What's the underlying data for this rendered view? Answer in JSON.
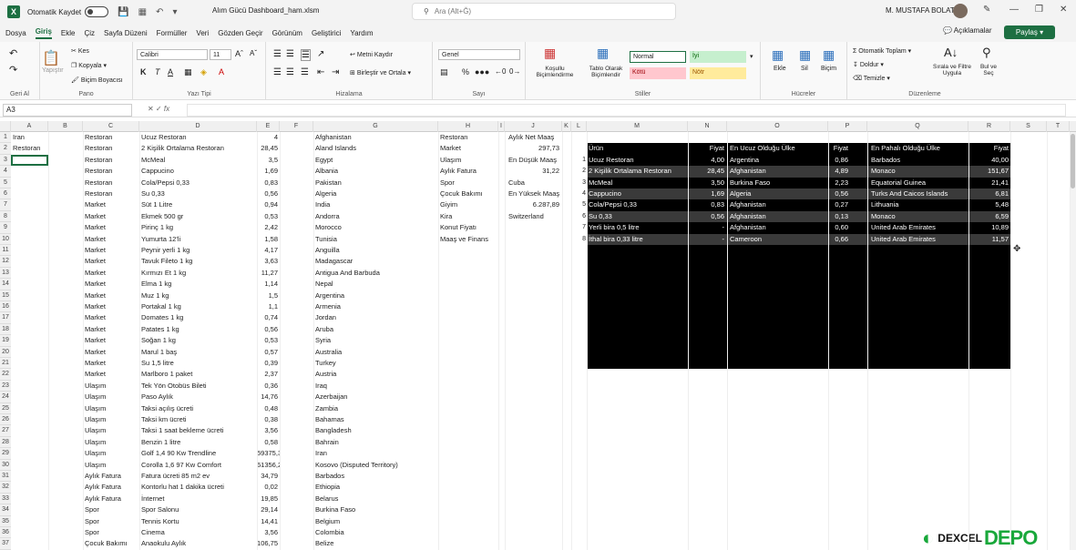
{
  "titlebar": {
    "autosave_label": "Otomatik Kaydet",
    "doc_title": "Alım Gücü Dashboard_ham.xlsm",
    "search_placeholder": "Ara (Alt+Ğ)",
    "user_name": "M. MUSTAFA BOLAT"
  },
  "menu": {
    "items": [
      "Dosya",
      "Giriş",
      "Ekle",
      "Çiz",
      "Sayfa Düzeni",
      "Formüller",
      "Veri",
      "Gözden Geçir",
      "Görünüm",
      "Geliştirici",
      "Yardım"
    ],
    "active_index": 1,
    "comments_label": "Açıklamalar",
    "share_label": "Paylaş"
  },
  "ribbon": {
    "groups": {
      "undo": "Geri Al",
      "clipboard": "Pano",
      "font": "Yazı Tipi",
      "alignment": "Hizalama",
      "number": "Sayı",
      "styles": "Stiller",
      "cells": "Hücreler",
      "editing": "Düzenleme"
    },
    "clipboard": {
      "paste": "Yapıştır",
      "cut": "Kes",
      "copy": "Kopyala",
      "format_painter": "Biçim Boyacısı"
    },
    "font": {
      "name": "Calibri",
      "size": "11"
    },
    "alignment": {
      "wrap": "Metni Kaydır",
      "merge": "Birleştir ve Ortala"
    },
    "number": {
      "format": "Genel"
    },
    "styles": {
      "conditional": "Koşullu Biçimlendirme",
      "table": "Tablo Olarak Biçimlendir",
      "normal": "Normal",
      "good": "İyi",
      "bad": "Kötü",
      "neutral": "Nötr"
    },
    "cells": {
      "insert": "Ekle",
      "delete": "Sil",
      "format": "Biçim"
    },
    "editing": {
      "autosum": "Otomatik Toplam",
      "fill": "Doldur",
      "clear": "Temizle",
      "sort": "Sırala ve Filtre Uygula",
      "find": "Bul ve Seç"
    }
  },
  "formula_bar": {
    "name_box": "A3",
    "fx": "fx"
  },
  "columns": [
    "A",
    "B",
    "C",
    "D",
    "E",
    "F",
    "G",
    "H",
    "I",
    "J",
    "K",
    "L",
    "M",
    "N",
    "O",
    "P",
    "Q",
    "R",
    "S",
    "T"
  ],
  "row_numbers": [
    1,
    2,
    3,
    4,
    5,
    6,
    7,
    8,
    9,
    10,
    11,
    12,
    13,
    14,
    15,
    16,
    17,
    18,
    19,
    20,
    21,
    22,
    23,
    24,
    25,
    26,
    27,
    28,
    29,
    30,
    31,
    32,
    33,
    34,
    35,
    36,
    37
  ],
  "col_a": [
    "Iran",
    "Restoran"
  ],
  "main_rows": [
    [
      "Restoran",
      "Ucuz Restoran",
      "4",
      "Afghanistan"
    ],
    [
      "Restoran",
      "2 Kişilik Ortalama Restoran",
      "28,45",
      "Aland Islands"
    ],
    [
      "Restoran",
      "McMeal",
      "3,5",
      "Egypt"
    ],
    [
      "Restoran",
      "Cappucino",
      "1,69",
      "Albania"
    ],
    [
      "Restoran",
      "Cola/Pepsi 0,33",
      "0,83",
      "Pakistan"
    ],
    [
      "Restoran",
      "Su 0,33",
      "0,56",
      "Algeria"
    ],
    [
      "Market",
      "Süt 1 Litre",
      "0,94",
      "India"
    ],
    [
      "Market",
      "Ekmek 500 gr",
      "0,53",
      "Andorra"
    ],
    [
      "Market",
      "Pirinç 1 kg",
      "2,42",
      "Morocco"
    ],
    [
      "Market",
      "Yumurta 12'li",
      "1,58",
      "Tunisia"
    ],
    [
      "Market",
      "Peynir yerli 1 kg",
      "4,17",
      "Anguilla"
    ],
    [
      "Market",
      "Tavuk Fileto 1 kg",
      "3,63",
      "Madagascar"
    ],
    [
      "Market",
      "Kırmızı Et 1 kg",
      "11,27",
      "Antigua And Barbuda"
    ],
    [
      "Market",
      "Elma 1 kg",
      "1,14",
      "Nepal"
    ],
    [
      "Market",
      "Muz 1 kg",
      "1,5",
      "Argentina"
    ],
    [
      "Market",
      "Portakal 1 kg",
      "1,1",
      "Armenia"
    ],
    [
      "Market",
      "Domates 1 kg",
      "0,74",
      "Jordan"
    ],
    [
      "Market",
      "Patates 1 kg",
      "0,56",
      "Aruba"
    ],
    [
      "Market",
      "Soğan 1 kg",
      "0,53",
      "Syria"
    ],
    [
      "Market",
      "Marul 1 baş",
      "0,57",
      "Australia"
    ],
    [
      "Market",
      "Su 1,5 litre",
      "0,39",
      "Turkey"
    ],
    [
      "Market",
      "Marlboro 1 paket",
      "2,37",
      "Austria"
    ],
    [
      "Ulaşım",
      "Tek Yön Otobüs Bileti",
      "0,36",
      "Iraq"
    ],
    [
      "Ulaşım",
      "Paso Aylık",
      "14,76",
      "Azerbaijan"
    ],
    [
      "Ulaşım",
      "Taksi açılış ücreti",
      "0,48",
      "Zambia"
    ],
    [
      "Ulaşım",
      "Taksi km ücreti",
      "0,38",
      "Bahamas"
    ],
    [
      "Ulaşım",
      "Taksi 1 saat bekleme ücreti",
      "3,56",
      "Bangladesh"
    ],
    [
      "Ulaşım",
      "Benzin 1 litre",
      "0,58",
      "Bahrain"
    ],
    [
      "Ulaşım",
      "Golf 1,4 90 Kw Trendline",
      "59375,37",
      "Iran"
    ],
    [
      "Ulaşım",
      "Corolla 1,6 97 Kw Comfort",
      "61356,28",
      "Kosovo (Disputed Territory)"
    ],
    [
      "Aylık Fatura",
      "Fatura ücreti 85 m2 ev",
      "34,79",
      "Barbados"
    ],
    [
      "Aylık Fatura",
      "Kontorlu hat 1 dakika ücreti",
      "0,02",
      "Ethiopia"
    ],
    [
      "Aylık Fatura",
      "İnternet",
      "19,85",
      "Belarus"
    ],
    [
      "Spor",
      "Spor Salonu",
      "29,14",
      "Burkina Faso"
    ],
    [
      "Spor",
      "Tennis Kortu",
      "14,41",
      "Belgium"
    ],
    [
      "Spor",
      "Cinema",
      "3,56",
      "Colombia"
    ],
    [
      "Çocuk Bakımı",
      "Anaokulu Aylık",
      "106,75",
      "Belize"
    ]
  ],
  "col_h": [
    "Restoran",
    "Market",
    "Ulaşım",
    "Aylık Fatura",
    "Spor",
    "Çocuk Bakımı",
    "Giyim",
    "Kira",
    "Konut Fiyatı",
    "Maaş ve Finans"
  ],
  "col_j": [
    "Aylık Net Maaş",
    "297,73",
    "En Düşük Maaş",
    "31,22",
    "Cuba",
    "En Yüksek Maaş",
    "6.287,89",
    "Switzerland"
  ],
  "dashboard": {
    "headers": [
      "Ürün",
      "Fiyat",
      "En Ucuz Olduğu Ülke",
      "Fiyat",
      "En Pahalı Olduğu Ülke",
      "Fiyat"
    ],
    "rows": [
      [
        "1",
        "Ucuz Restoran",
        "4,00",
        "Argentina",
        "0,86",
        "Barbados",
        "40,00"
      ],
      [
        "2",
        "2 Kişilik Ortalama Restoran",
        "28,45",
        "Afghanistan",
        "4,89",
        "Monaco",
        "151,67"
      ],
      [
        "3",
        "McMeal",
        "3,50",
        "Burkina Faso",
        "2,23",
        "Equatorial Guinea",
        "21,41"
      ],
      [
        "4",
        "Cappucino",
        "1,69",
        "Algeria",
        "0,56",
        "Turks And Caicos Islands",
        "6,81"
      ],
      [
        "5",
        "Cola/Pepsi 0,33",
        "0,83",
        "Afghanistan",
        "0,27",
        "Lithuania",
        "5,48"
      ],
      [
        "6",
        "Su 0,33",
        "0,56",
        "Afghanistan",
        "0,13",
        "Monaco",
        "6,59"
      ],
      [
        "7",
        "Yerli bira 0,5 litre",
        "-",
        "Afghanistan",
        "0,60",
        "United Arab Emirates",
        "10,89"
      ],
      [
        "8",
        "İthal bira 0,33 litre",
        "-",
        "Cameroon",
        "0,66",
        "United Arab Emirates",
        "11,57"
      ]
    ]
  },
  "watermark": {
    "dexcel": "DEXCEL",
    "depo": "DEPO"
  },
  "colors": {
    "excel_green": "#1d6f42",
    "dashboard_bg": "#000000",
    "row_alt": "#3a3a3a",
    "good": "#c6efce",
    "bad": "#ffc7ce",
    "neutral": "#ffeb9c"
  }
}
